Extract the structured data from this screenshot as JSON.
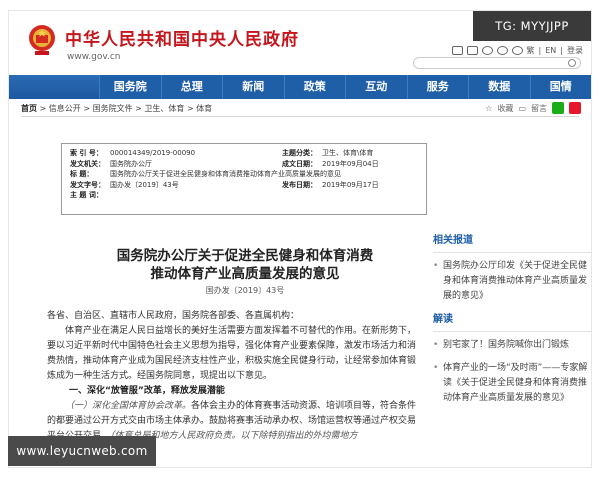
{
  "header": {
    "site_title": "中华人民共和国中央人民政府",
    "site_url": "www.gov.cn",
    "tools": [
      "繁",
      "EN",
      "登录"
    ],
    "tg_badge": "TG: MYYJJPP"
  },
  "nav": {
    "items": [
      "国务院",
      "总理",
      "新闻",
      "政策",
      "互动",
      "服务",
      "数据",
      "国情"
    ]
  },
  "breadcrumb": {
    "items": [
      "首页",
      "信息公开",
      "国务院文件",
      "卫生、体育",
      "体育"
    ]
  },
  "share": {
    "labels": [
      "收藏",
      "留言"
    ]
  },
  "meta": {
    "rows": [
      {
        "l1": "索 引 号：",
        "v1": "000014349/2019-00090",
        "l2": "主题分类：",
        "v2": "卫生、体育\\体育"
      },
      {
        "l1": "发文机关：",
        "v1": "国务院办公厅",
        "l2": "成文日期：",
        "v2": "2019年09月04日"
      },
      {
        "l1": "标    题：",
        "v1": "国务院办公厅关于促进全民健身和体育消费推动体育产业高质量发展的意见",
        "l2": "",
        "v2": ""
      },
      {
        "l1": "发文字号：",
        "v1": "国办发〔2019〕43号",
        "l2": "发布日期：",
        "v2": "2019年09月17日"
      },
      {
        "l1": "主 题 词：",
        "v1": "",
        "l2": "",
        "v2": ""
      }
    ]
  },
  "article": {
    "title_line1": "国务院办公厅关于促进全民健身和体育消费",
    "title_line2": "推动体育产业高质量发展的意见",
    "doc_no": "国办发〔2019〕43号",
    "greeting": "各省、自治区、直辖市人民政府，国务院各部委、各直属机构：",
    "para1": "体育产业在满足人民日益增长的美好生活需要方面发挥着不可替代的作用。在新形势下，要以习近平新时代中国特色社会主义思想为指导，强化体育产业要素保障，激发市场活力和消费热情，推动体育产业成为国民经济支柱性产业，积极实施全民健身行动，让经常参加体育锻炼成为一种生活方式。经国务院同意，现提出以下意见。",
    "section1": "一、深化“放管服”改革，释放发展潜能",
    "para2_lead": "（一）深化全国体育协会改革。",
    "para2": "各体会主办的体育赛事活动资源、培训项目等，符合条件的都要通过公开方式交由市场主体承办。鼓励将赛事活动承办权、场馆运营权等通过产权交易平台公开交易。",
    "para2_note": "（体育总局和地方人民政府负责。以下除特别指出的外均需地方"
  },
  "sidebar": {
    "related_head": "相关报道",
    "related": [
      "国务院办公厅印发《关于促进全民健身和体育消费推动体育产业高质量发展的意见》"
    ],
    "interp_head": "解读",
    "interp": [
      "别宅家了！国务院喊你出门锻炼",
      "体育产业的一场“及时雨”——专家解读《关于促进全民健身和体育消费推动体育产业高质量发展的意见》"
    ]
  },
  "watermark": "www.leyucnweb.com",
  "colors": {
    "brand_red": "#c4161c",
    "nav_blue": "#1f5fa8"
  }
}
